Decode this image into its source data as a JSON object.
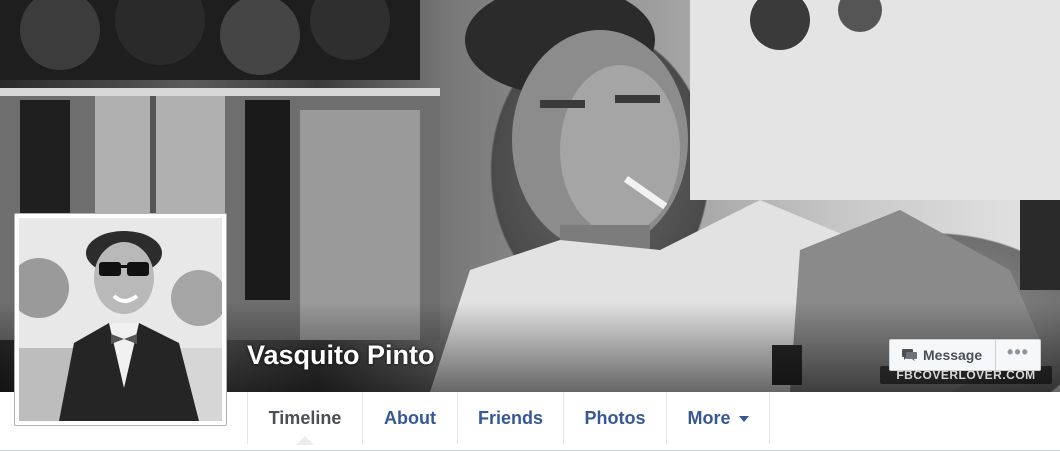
{
  "profile": {
    "name": "Vasquito Pinto"
  },
  "cover": {
    "watermark": "FBCOVERLOVER.COM"
  },
  "actions": {
    "message_label": "Message",
    "more_label": "•••"
  },
  "tabs": [
    {
      "label": "Timeline",
      "active": true
    },
    {
      "label": "About",
      "active": false
    },
    {
      "label": "Friends",
      "active": false
    },
    {
      "label": "Photos",
      "active": false
    },
    {
      "label": "More",
      "active": false
    }
  ],
  "colors": {
    "link": "#365899",
    "active_tab": "#4b4f56",
    "page_bg": "#e9ebee"
  }
}
